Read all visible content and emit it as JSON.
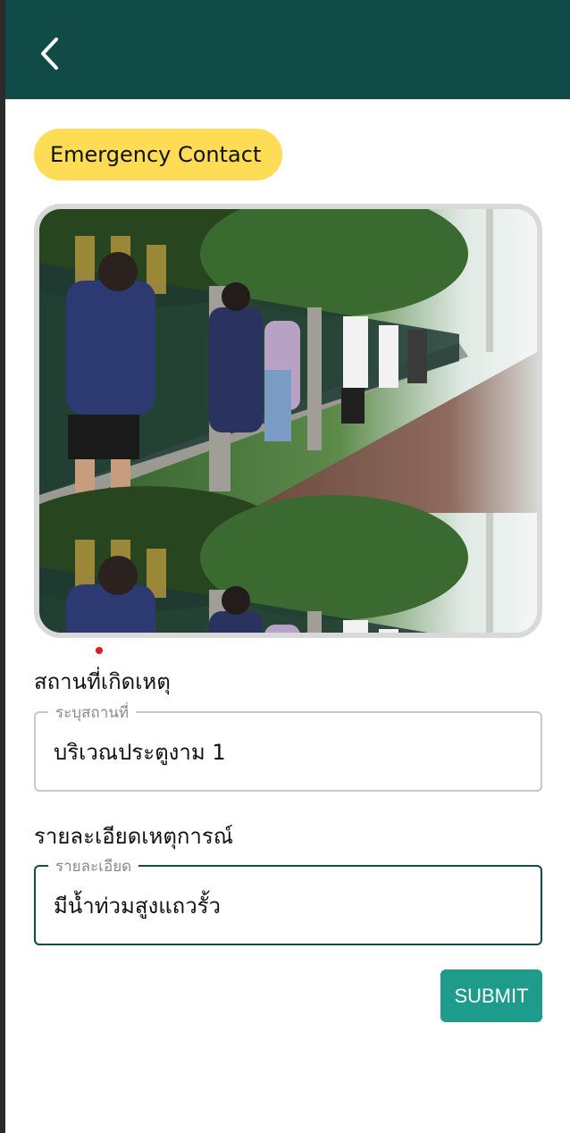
{
  "app_bar": {
    "back_icon": "chevron-left-icon",
    "color": "#114b48"
  },
  "chip": {
    "label": "Emergency Contact",
    "color": "#ffdc55"
  },
  "photo": {
    "subject": "flood-photo"
  },
  "location": {
    "section_label": "สถานที่เกิดเหตุ",
    "field_label": "ระบุสถานที่",
    "value": "บริเวณประตูงาม 1"
  },
  "details": {
    "section_label": "รายละเอียดเหตุการณ์",
    "field_label": "รายละเอียด",
    "value": "มีน้ำท่วมสูงแถวรั้ว"
  },
  "submit": {
    "label": "SUBMIT",
    "color": "#1f9b8c"
  }
}
